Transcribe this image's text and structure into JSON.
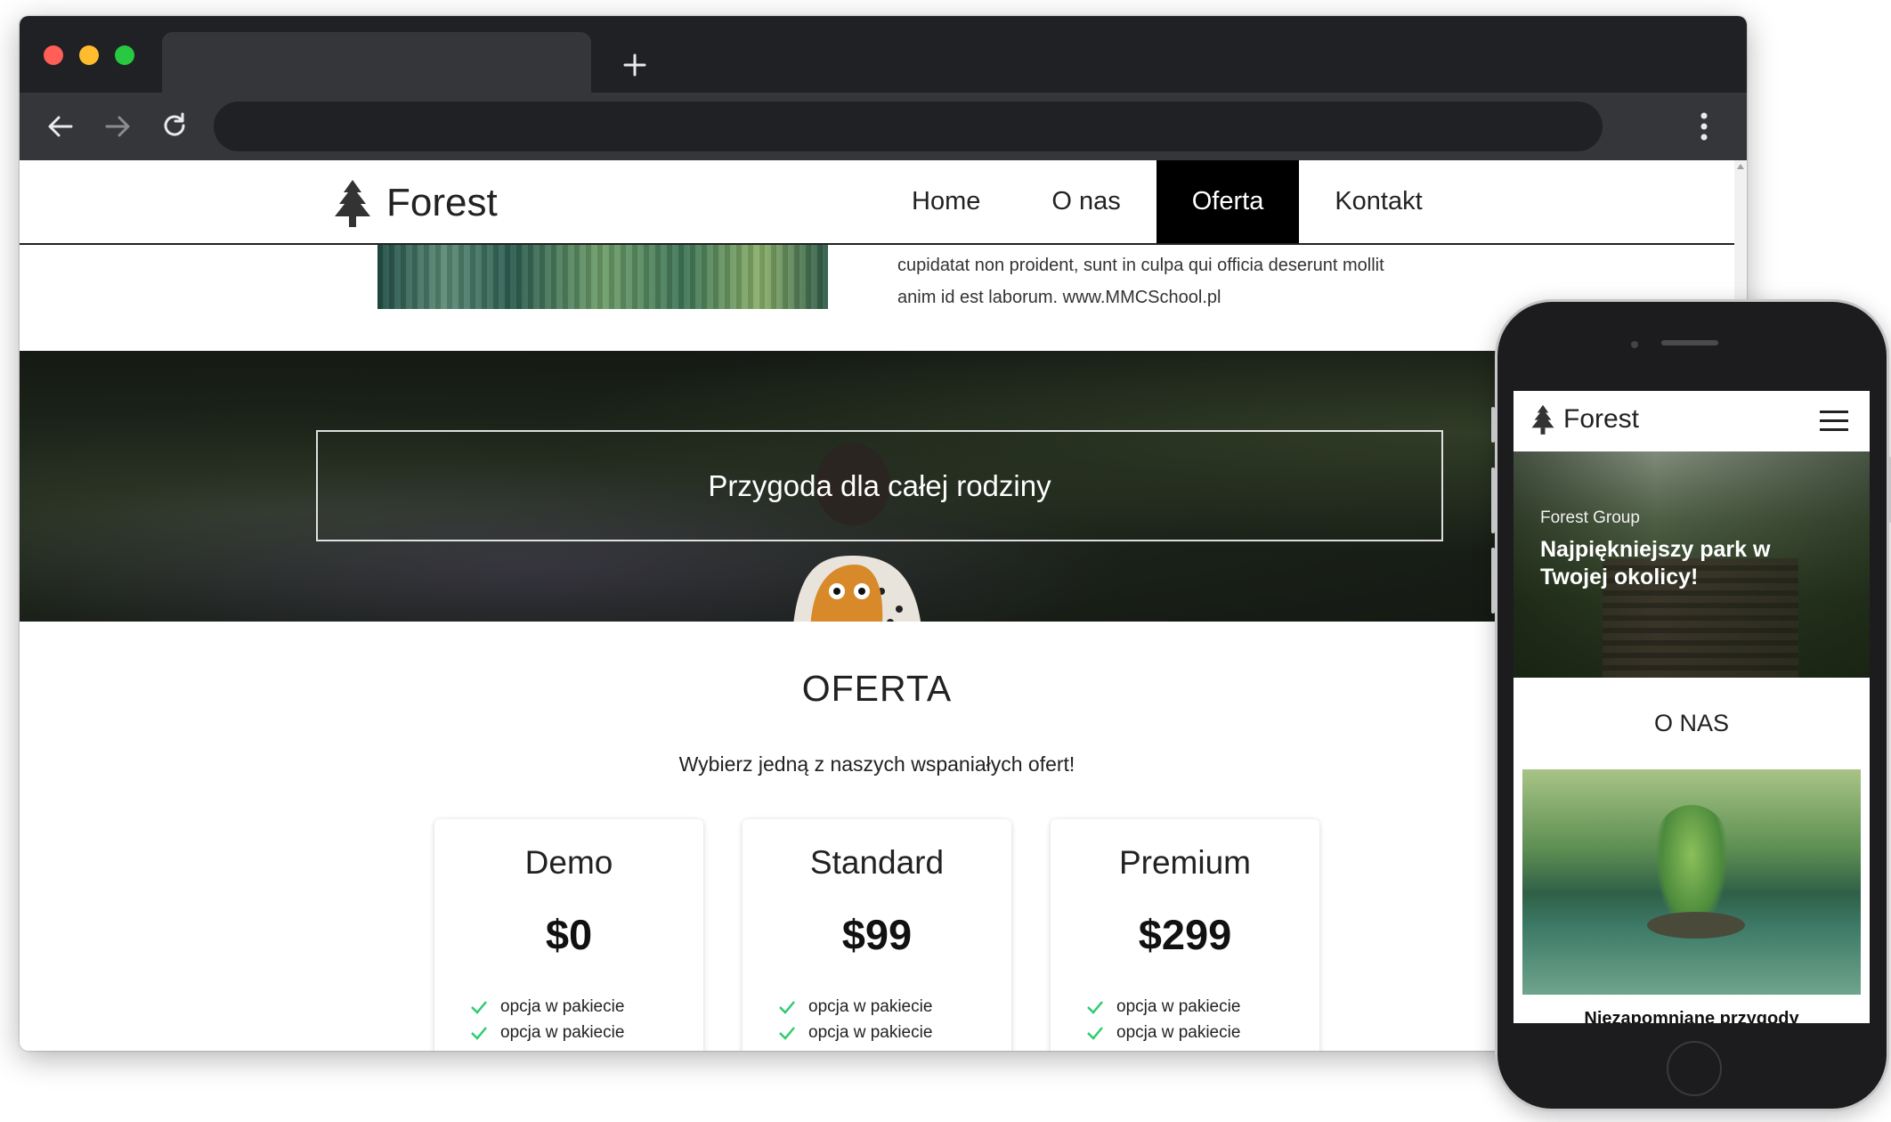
{
  "desktop": {
    "brand": "Forest",
    "nav": [
      "Home",
      "O nas",
      "Oferta",
      "Kontakt"
    ],
    "active_nav": "Oferta",
    "about_text_line1": "cupidatat non proident, sunt in culpa qui officia deserunt mollit",
    "about_text_line2": "anim id est laborum. www.MMCSchool.pl",
    "hero_title": "Przygoda dla całej rodziny",
    "section_title": "OFERTA",
    "section_subtitle": "Wybierz jedną z naszych wspaniałych ofert!",
    "pricing": [
      {
        "name": "Demo",
        "price": "$0",
        "features": [
          "opcja w pakiecie",
          "opcja w pakiecie"
        ]
      },
      {
        "name": "Standard",
        "price": "$99",
        "features": [
          "opcja w pakiecie",
          "opcja w pakiecie"
        ]
      },
      {
        "name": "Premium",
        "price": "$299",
        "features": [
          "opcja w pakiecie",
          "opcja w pakiecie"
        ]
      }
    ],
    "accent_check_color": "#2ecc71"
  },
  "mobile": {
    "brand": "Forest",
    "hero_kicker": "Forest Group",
    "hero_title": "Najpiękniejszy park w Twojej okolicy!",
    "section_title": "O NAS",
    "about_caption": "Niezapomniane przygody"
  },
  "icons": {
    "logo": "tree-icon",
    "back": "arrow-left-icon",
    "forward": "arrow-right-icon",
    "reload": "reload-icon",
    "menu": "three-dots-icon",
    "new_tab": "plus-icon",
    "feature": "check-icon",
    "hamburger": "hamburger-icon"
  }
}
